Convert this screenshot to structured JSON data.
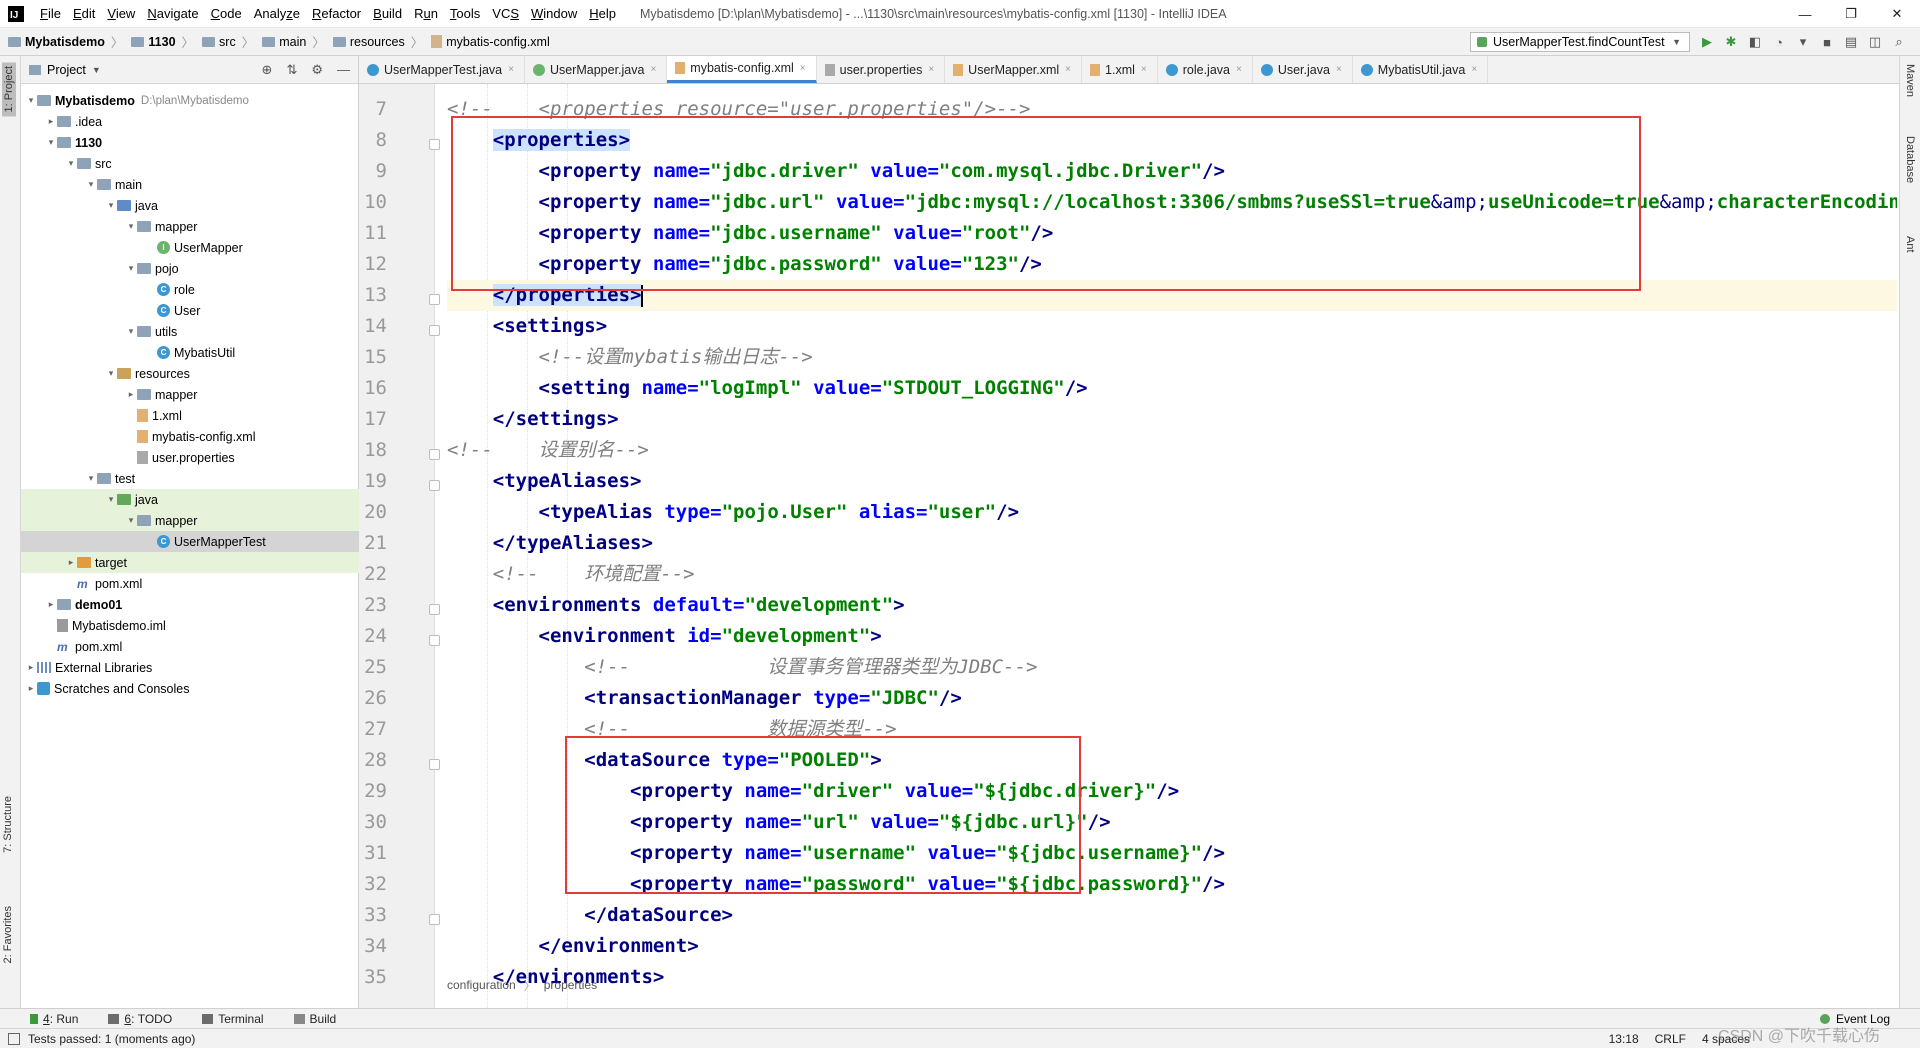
{
  "menubar": {
    "logo": "IJ",
    "items": [
      {
        "pre": "",
        "ul": "F",
        "post": "ile"
      },
      {
        "pre": "",
        "ul": "E",
        "post": "dit"
      },
      {
        "pre": "",
        "ul": "V",
        "post": "iew"
      },
      {
        "pre": "",
        "ul": "N",
        "post": "avigate"
      },
      {
        "pre": "",
        "ul": "C",
        "post": "ode"
      },
      {
        "pre": "Analy",
        "ul": "z",
        "post": "e"
      },
      {
        "pre": "",
        "ul": "R",
        "post": "efactor"
      },
      {
        "pre": "",
        "ul": "B",
        "post": "uild"
      },
      {
        "pre": "R",
        "ul": "u",
        "post": "n"
      },
      {
        "pre": "",
        "ul": "T",
        "post": "ools"
      },
      {
        "pre": "VC",
        "ul": "S",
        "post": ""
      },
      {
        "pre": "",
        "ul": "W",
        "post": "indow"
      },
      {
        "pre": "",
        "ul": "H",
        "post": "elp"
      }
    ],
    "window_title": "Mybatisdemo [D:\\plan\\Mybatisdemo] - ...\\1130\\src\\main\\resources\\mybatis-config.xml [1130] - IntelliJ IDEA",
    "minimize": "—",
    "restore": "❐",
    "close": "✕"
  },
  "navbar": {
    "crumbs": [
      "Mybatisdemo",
      "1130",
      "src",
      "main",
      "resources",
      "mybatis-config.xml"
    ],
    "run_config": "UserMapperTest.findCountTest"
  },
  "project_panel": {
    "title": "Project",
    "tree": [
      {
        "depth": 0,
        "arrow": "▾",
        "icon": "folder",
        "label": "Mybatisdemo",
        "bold": true,
        "extra": "D:\\plan\\Mybatisdemo"
      },
      {
        "depth": 1,
        "arrow": "▸",
        "icon": "folder",
        "label": ".idea"
      },
      {
        "depth": 1,
        "arrow": "▾",
        "icon": "folder",
        "label": "1130",
        "bold": true
      },
      {
        "depth": 2,
        "arrow": "▾",
        "icon": "folder",
        "label": "src"
      },
      {
        "depth": 3,
        "arrow": "▾",
        "icon": "folder",
        "label": "main"
      },
      {
        "depth": 4,
        "arrow": "▾",
        "icon": "folder-src",
        "label": "java"
      },
      {
        "depth": 5,
        "arrow": "▾",
        "icon": "folder",
        "label": "mapper"
      },
      {
        "depth": 6,
        "arrow": "",
        "icon": "iface",
        "label": "UserMapper"
      },
      {
        "depth": 5,
        "arrow": "▾",
        "icon": "folder",
        "label": "pojo"
      },
      {
        "depth": 6,
        "arrow": "",
        "icon": "class",
        "label": "role"
      },
      {
        "depth": 6,
        "arrow": "",
        "icon": "class",
        "label": "User"
      },
      {
        "depth": 5,
        "arrow": "▾",
        "icon": "folder",
        "label": "utils"
      },
      {
        "depth": 6,
        "arrow": "",
        "icon": "class",
        "label": "MybatisUtil"
      },
      {
        "depth": 4,
        "arrow": "▾",
        "icon": "folder-res",
        "label": "resources"
      },
      {
        "depth": 5,
        "arrow": "▸",
        "icon": "folder",
        "label": "mapper"
      },
      {
        "depth": 5,
        "arrow": "",
        "icon": "xml",
        "label": "1.xml"
      },
      {
        "depth": 5,
        "arrow": "",
        "icon": "xml",
        "label": "mybatis-config.xml"
      },
      {
        "depth": 5,
        "arrow": "",
        "icon": "props",
        "label": "user.properties"
      },
      {
        "depth": 3,
        "arrow": "▾",
        "icon": "folder",
        "label": "test"
      },
      {
        "depth": 4,
        "arrow": "▾",
        "icon": "folder-test",
        "label": "java",
        "hl": "green"
      },
      {
        "depth": 5,
        "arrow": "▾",
        "icon": "folder",
        "label": "mapper",
        "hl": "green"
      },
      {
        "depth": 6,
        "arrow": "",
        "icon": "class",
        "label": "UserMapperTest",
        "hl": "sel"
      },
      {
        "depth": 2,
        "arrow": "▸",
        "icon": "folder-orange",
        "label": "target",
        "hl": "green"
      },
      {
        "depth": 2,
        "arrow": "",
        "icon": "m",
        "label": "pom.xml"
      },
      {
        "depth": 1,
        "arrow": "▸",
        "icon": "folder",
        "label": "demo01",
        "bold": true
      },
      {
        "depth": 1,
        "arrow": "",
        "icon": "iml",
        "label": "Mybatisdemo.iml"
      },
      {
        "depth": 1,
        "arrow": "",
        "icon": "m",
        "label": "pom.xml"
      },
      {
        "depth": 0,
        "arrow": "▸",
        "icon": "lib",
        "label": "External Libraries"
      },
      {
        "depth": 0,
        "arrow": "▸",
        "icon": "scratch",
        "label": "Scratches and Consoles"
      }
    ]
  },
  "editor": {
    "tabs": [
      {
        "icon": "c",
        "label": "UserMapperTest.java"
      },
      {
        "icon": "i",
        "label": "UserMapper.java"
      },
      {
        "icon": "x",
        "label": "mybatis-config.xml",
        "active": true
      },
      {
        "icon": "p",
        "label": "user.properties"
      },
      {
        "icon": "x",
        "label": "UserMapper.xml"
      },
      {
        "icon": "x",
        "label": "1.xml"
      },
      {
        "icon": "c",
        "label": "role.java"
      },
      {
        "icon": "c",
        "label": "User.java"
      },
      {
        "icon": "c",
        "label": "MybatisUtil.java"
      }
    ],
    "current_line": 13,
    "lines": [
      {
        "n": 7,
        "fold": false,
        "tokens": [
          [
            "com",
            "<!--    <properties resource=\"user.properties\"/>-->"
          ]
        ]
      },
      {
        "n": 8,
        "fold": true,
        "tokens": [
          [
            "sp",
            "    "
          ],
          [
            "taghl",
            "<properties>"
          ]
        ]
      },
      {
        "n": 9,
        "fold": false,
        "tokens": [
          [
            "sp",
            "        "
          ],
          [
            "tag",
            "<property "
          ],
          [
            "attr",
            "name="
          ],
          [
            "val",
            "\"jdbc.driver\" "
          ],
          [
            "attr",
            "value="
          ],
          [
            "val",
            "\"com.mysql.jdbc.Driver\""
          ],
          [
            "tag",
            "/>"
          ]
        ]
      },
      {
        "n": 10,
        "fold": false,
        "tokens": [
          [
            "sp",
            "        "
          ],
          [
            "tag",
            "<property "
          ],
          [
            "attr",
            "name="
          ],
          [
            "val",
            "\"jdbc.url\" "
          ],
          [
            "attr",
            "value="
          ],
          [
            "val",
            "\"jdbc:mysql://localhost:3306/smbms?useSSl=true"
          ],
          [
            "amp",
            "&amp;"
          ],
          [
            "val",
            "useUnicode=true"
          ],
          [
            "amp",
            "&amp;"
          ],
          [
            "val",
            "characterEncoding"
          ]
        ]
      },
      {
        "n": 11,
        "fold": false,
        "tokens": [
          [
            "sp",
            "        "
          ],
          [
            "tag",
            "<property "
          ],
          [
            "attr",
            "name="
          ],
          [
            "val",
            "\"jdbc.username\" "
          ],
          [
            "attr",
            "value="
          ],
          [
            "val",
            "\"root\""
          ],
          [
            "tag",
            "/>"
          ]
        ]
      },
      {
        "n": 12,
        "fold": false,
        "tokens": [
          [
            "sp",
            "        "
          ],
          [
            "tag",
            "<property "
          ],
          [
            "attr",
            "name="
          ],
          [
            "val",
            "\"jdbc.password\" "
          ],
          [
            "attr",
            "value="
          ],
          [
            "val",
            "\"123\""
          ],
          [
            "tag",
            "/>"
          ]
        ]
      },
      {
        "n": 13,
        "fold": true,
        "tokens": [
          [
            "sp",
            "    "
          ],
          [
            "taghl",
            "</properties>"
          ],
          [
            "caret",
            ""
          ]
        ]
      },
      {
        "n": 14,
        "fold": true,
        "tokens": [
          [
            "sp",
            "    "
          ],
          [
            "tag",
            "<settings>"
          ]
        ]
      },
      {
        "n": 15,
        "fold": false,
        "tokens": [
          [
            "sp",
            "        "
          ],
          [
            "com",
            "<!--设置mybatis输出日志-->"
          ]
        ]
      },
      {
        "n": 16,
        "fold": false,
        "tokens": [
          [
            "sp",
            "        "
          ],
          [
            "tag",
            "<setting "
          ],
          [
            "attr",
            "name="
          ],
          [
            "val",
            "\"logImpl\" "
          ],
          [
            "attr",
            "value="
          ],
          [
            "val",
            "\"STDOUT_LOGGING\""
          ],
          [
            "tag",
            "/>"
          ]
        ]
      },
      {
        "n": 17,
        "fold": false,
        "tokens": [
          [
            "sp",
            "    "
          ],
          [
            "tag",
            "</settings>"
          ]
        ]
      },
      {
        "n": 18,
        "fold": true,
        "tokens": [
          [
            "com",
            "<!--    设置别名-->"
          ]
        ]
      },
      {
        "n": 19,
        "fold": true,
        "tokens": [
          [
            "sp",
            "    "
          ],
          [
            "tag",
            "<typeAliases>"
          ]
        ]
      },
      {
        "n": 20,
        "fold": false,
        "tokens": [
          [
            "sp",
            "        "
          ],
          [
            "tag",
            "<typeAlias "
          ],
          [
            "attr",
            "type="
          ],
          [
            "val",
            "\"pojo.User\" "
          ],
          [
            "attr",
            "alias="
          ],
          [
            "val",
            "\"user\""
          ],
          [
            "tag",
            "/>"
          ]
        ]
      },
      {
        "n": 21,
        "fold": false,
        "tokens": [
          [
            "sp",
            "    "
          ],
          [
            "tag",
            "</typeAliases>"
          ]
        ]
      },
      {
        "n": 22,
        "fold": false,
        "tokens": [
          [
            "sp",
            "    "
          ],
          [
            "com",
            "<!--    环境配置-->"
          ]
        ]
      },
      {
        "n": 23,
        "fold": true,
        "tokens": [
          [
            "sp",
            "    "
          ],
          [
            "tag",
            "<environments "
          ],
          [
            "attr",
            "default="
          ],
          [
            "val",
            "\"development\""
          ],
          [
            "tag",
            ">"
          ]
        ]
      },
      {
        "n": 24,
        "fold": true,
        "tokens": [
          [
            "sp",
            "        "
          ],
          [
            "tag",
            "<environment "
          ],
          [
            "attr",
            "id="
          ],
          [
            "val",
            "\"development\""
          ],
          [
            "tag",
            ">"
          ]
        ]
      },
      {
        "n": 25,
        "fold": false,
        "tokens": [
          [
            "sp",
            "            "
          ],
          [
            "com",
            "<!--            设置事务管理器类型为JDBC-->"
          ]
        ]
      },
      {
        "n": 26,
        "fold": false,
        "tokens": [
          [
            "sp",
            "            "
          ],
          [
            "tag",
            "<transactionManager "
          ],
          [
            "attr",
            "type="
          ],
          [
            "val",
            "\"JDBC\""
          ],
          [
            "tag",
            "/>"
          ]
        ]
      },
      {
        "n": 27,
        "fold": false,
        "tokens": [
          [
            "sp",
            "            "
          ],
          [
            "com",
            "<!--            数据源类型-->"
          ]
        ]
      },
      {
        "n": 28,
        "fold": true,
        "tokens": [
          [
            "sp",
            "            "
          ],
          [
            "tag",
            "<dataSource "
          ],
          [
            "attr",
            "type="
          ],
          [
            "val",
            "\"POOLED\""
          ],
          [
            "tag",
            ">"
          ]
        ]
      },
      {
        "n": 29,
        "fold": false,
        "tokens": [
          [
            "sp",
            "                "
          ],
          [
            "tag",
            "<property "
          ],
          [
            "attr",
            "name="
          ],
          [
            "val",
            "\"driver\" "
          ],
          [
            "attr",
            "value="
          ],
          [
            "val",
            "\"${jdbc.driver}\""
          ],
          [
            "tag",
            "/>"
          ]
        ]
      },
      {
        "n": 30,
        "fold": false,
        "tokens": [
          [
            "sp",
            "                "
          ],
          [
            "tag",
            "<property "
          ],
          [
            "attr",
            "name="
          ],
          [
            "val",
            "\"url\" "
          ],
          [
            "attr",
            "value="
          ],
          [
            "val",
            "\"${jdbc.url}\""
          ],
          [
            "tag",
            "/>"
          ]
        ]
      },
      {
        "n": 31,
        "fold": false,
        "tokens": [
          [
            "sp",
            "                "
          ],
          [
            "tag",
            "<property "
          ],
          [
            "attr",
            "name="
          ],
          [
            "val",
            "\"username\" "
          ],
          [
            "attr",
            "value="
          ],
          [
            "val",
            "\"${jdbc.username}\""
          ],
          [
            "tag",
            "/>"
          ]
        ]
      },
      {
        "n": 32,
        "fold": false,
        "tokens": [
          [
            "sp",
            "                "
          ],
          [
            "tag",
            "<property "
          ],
          [
            "attr",
            "name="
          ],
          [
            "val",
            "\"password\" "
          ],
          [
            "attr",
            "value="
          ],
          [
            "val",
            "\"${jdbc.password}\""
          ],
          [
            "tag",
            "/>"
          ]
        ]
      },
      {
        "n": 33,
        "fold": true,
        "tokens": [
          [
            "sp",
            "            "
          ],
          [
            "tag",
            "</dataSource>"
          ]
        ]
      },
      {
        "n": 34,
        "fold": false,
        "tokens": [
          [
            "sp",
            "        "
          ],
          [
            "tag",
            "</environment>"
          ]
        ]
      },
      {
        "n": 35,
        "fold": false,
        "tokens": [
          [
            "sp",
            "    "
          ],
          [
            "tag",
            "</environments>"
          ]
        ]
      }
    ],
    "breadcrumb": [
      "configuration",
      "properties"
    ]
  },
  "left_stripe": {
    "project_tab": "1: Project",
    "structure_tab": "7: Structure",
    "favorites_tab": "2: Favorites"
  },
  "right_stripe": {
    "maven": "Maven",
    "database": "Database",
    "ant": "Ant"
  },
  "bottom_bar": {
    "tabs": [
      {
        "num": "4",
        "label": "Run"
      },
      {
        "num": "6",
        "label": "TODO"
      },
      {
        "num": "",
        "label": "Terminal"
      },
      {
        "num": "",
        "label": "Build"
      }
    ],
    "event_log": "Event Log"
  },
  "status_bar": {
    "message": "Tests passed: 1 (moments ago)",
    "position": "13:18",
    "line_sep": "CRLF",
    "indent": "4 spaces",
    "watermark": "CSDN @下吹千载心伤"
  }
}
